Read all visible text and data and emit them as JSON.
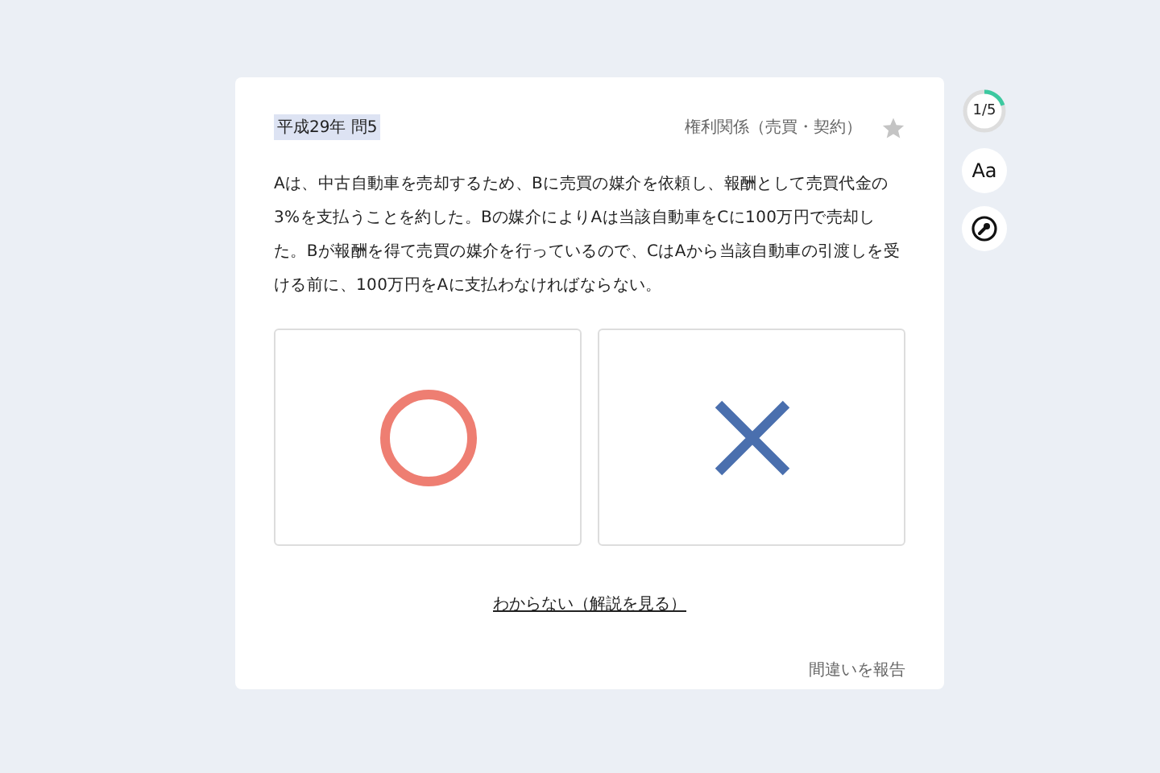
{
  "question": {
    "tag": "平成29年 問5",
    "category": "権利関係（売買・契約）",
    "starred": false,
    "text": "Aは、中古自動車を売却するため、Bに売買の媒介を依頼し、報酬として売買代金の3%を支払うことを約した。Bの媒介によりAは当該自動車をCに100万円で売却した。Bが報酬を得て売買の媒介を行っているので、CはAから当該自動車の引渡しを受ける前に、100万円をAに支払わなければならない。"
  },
  "answers": [
    {
      "kind": "circle",
      "selected": false
    },
    {
      "kind": "cross",
      "selected": false
    }
  ],
  "unknown_link": "わからない（解説を見る）",
  "report_link": "間違いを報告",
  "side": {
    "progress": {
      "label": "1/5",
      "level": 0.2
    },
    "font_button": "Aa"
  }
}
